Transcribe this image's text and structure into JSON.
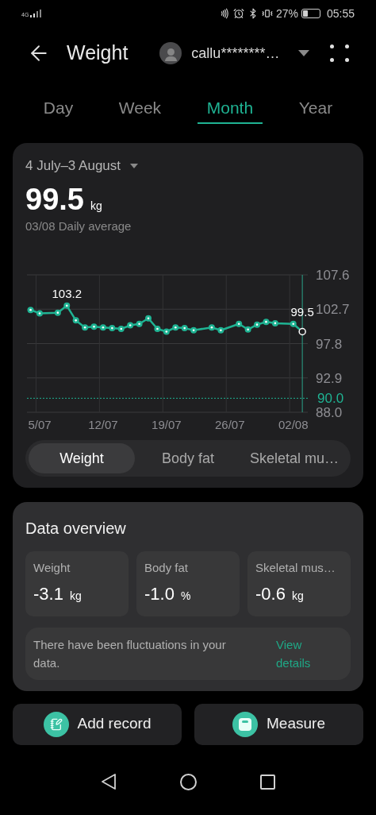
{
  "status_bar": {
    "network": "4G",
    "battery": "27%",
    "time": "05:55"
  },
  "header": {
    "title": "Weight",
    "account": "callu********…"
  },
  "period_tabs": [
    {
      "label": "Day",
      "selected": false
    },
    {
      "label": "Week",
      "selected": false
    },
    {
      "label": "Month",
      "selected": true
    },
    {
      "label": "Year",
      "selected": false
    }
  ],
  "summary": {
    "date_range": "4 July–3 August",
    "value": "99.5",
    "unit": "kg",
    "caption": "03/08 Daily average",
    "chart_data": {
      "type": "line",
      "ylim": [
        88,
        107.6
      ],
      "categories": [
        null,
        "5/07",
        null,
        null,
        null,
        null,
        null,
        null,
        "12/07",
        null,
        null,
        null,
        null,
        null,
        null,
        "19/07",
        null,
        null,
        null,
        null,
        null,
        null,
        "26/07",
        null,
        null,
        null,
        null,
        null,
        null,
        "02/08",
        null
      ],
      "grid": true,
      "series": [
        {
          "color": "#1fb393",
          "marker": "circle",
          "values": [
            102.6,
            102.1,
            null,
            102.2,
            103.2,
            101.1,
            100.1,
            100.2,
            100.1,
            100.0,
            99.9,
            100.4,
            100.6,
            101.4,
            99.9,
            99.5,
            100.1,
            100.0,
            99.7,
            null,
            100.1,
            99.7,
            null,
            100.6,
            99.8,
            100.5,
            100.9,
            100.7,
            null,
            100.6,
            99.5
          ]
        }
      ],
      "yticks": [
        {
          "value": 88,
          "label": "88.0"
        },
        {
          "value": 92.9,
          "label": "92.9"
        },
        {
          "value": 97.8,
          "label": "97.8"
        },
        {
          "value": 102.7,
          "label": "102.7"
        },
        {
          "value": 107.6,
          "label": "107.6"
        }
      ],
      "annotations": [
        {
          "y": 103.2,
          "text": "103.2"
        },
        {
          "y": 99.5,
          "text": "99.5"
        }
      ],
      "ref_lines": [
        {
          "axis": "y",
          "value": 90,
          "label": "90.0",
          "color": "#1fb393"
        }
      ]
    }
  },
  "metric_tabs": [
    {
      "label": "Weight",
      "selected": true
    },
    {
      "label": "Body fat",
      "selected": false
    },
    {
      "label": "Skeletal mu…",
      "selected": false
    }
  ],
  "overview": {
    "title": "Data overview",
    "metrics": [
      {
        "label": "Weight",
        "value": "-3.1",
        "unit": "kg"
      },
      {
        "label": "Body fat",
        "value": "-1.0",
        "unit": "%"
      },
      {
        "label": "Skeletal mus…",
        "value": "-0.6",
        "unit": "kg"
      }
    ],
    "notice": "There have been fluctuations in your data.",
    "link": "View details"
  },
  "actions": [
    {
      "label": "Add record",
      "kind": "record"
    },
    {
      "label": "Measure",
      "kind": "measure"
    }
  ]
}
